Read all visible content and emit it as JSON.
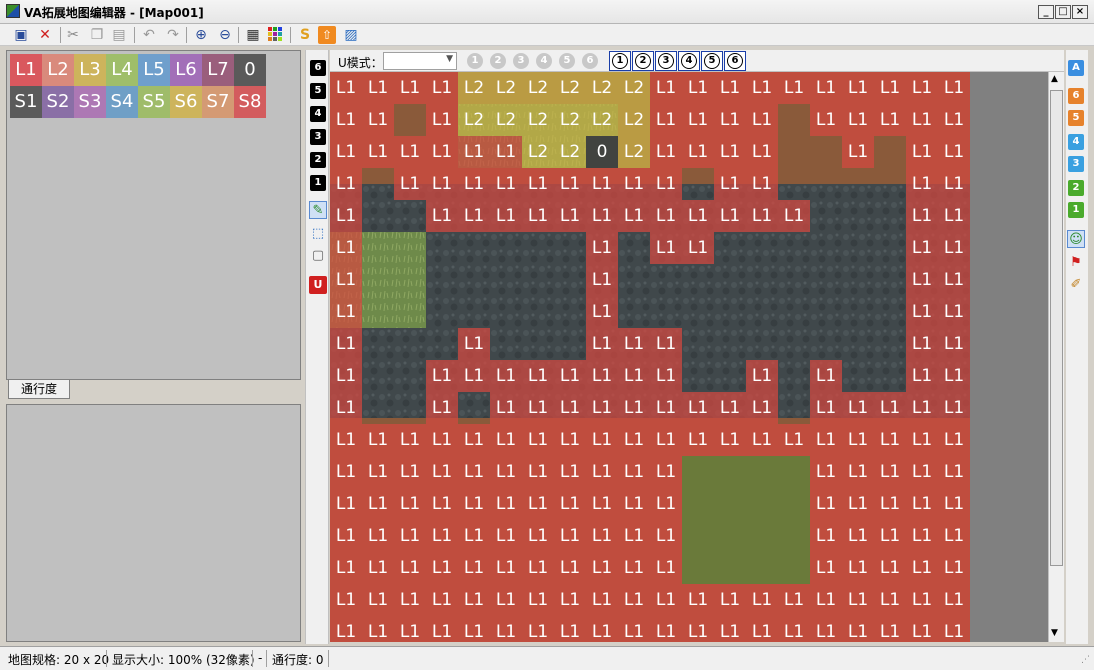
{
  "window": {
    "title": "VA拓展地图编辑器 - [Map001]",
    "buttons": [
      "_",
      "□",
      "×"
    ]
  },
  "toolbar": {
    "icons": [
      "save-icon",
      "delete-icon",
      "cut-icon",
      "copy-icon",
      "paste-icon",
      "undo-icon",
      "redo-icon",
      "zoom-in-icon",
      "zoom-out-icon",
      "grid-icon",
      "palette-icon",
      "script-icon",
      "upload-icon",
      "image-icon"
    ]
  },
  "palette": {
    "row1": [
      {
        "label": "L1",
        "color": "#d9585e"
      },
      {
        "label": "L2",
        "color": "#d98a7c"
      },
      {
        "label": "L3",
        "color": "#cdb45c"
      },
      {
        "label": "L4",
        "color": "#9fbe6a"
      },
      {
        "label": "L5",
        "color": "#6f9fcc"
      },
      {
        "label": "L6",
        "color": "#a26fb8"
      },
      {
        "label": "L7",
        "color": "#9a5e7c"
      },
      {
        "label": "0",
        "color": "#5a5a5a"
      }
    ],
    "row2": [
      {
        "label": "S1",
        "color": "#5b5b5b"
      },
      {
        "label": "S2",
        "color": "#8a6fa6"
      },
      {
        "label": "S3",
        "color": "#ad78b4"
      },
      {
        "label": "S4",
        "color": "#6f9fc6"
      },
      {
        "label": "S5",
        "color": "#9fbc6a"
      },
      {
        "label": "S6",
        "color": "#cdb45c"
      },
      {
        "label": "S7",
        "color": "#d49a74"
      },
      {
        "label": "S8",
        "color": "#d35c5e"
      }
    ]
  },
  "tabs": {
    "passability": "通行度"
  },
  "layer_buttons": [
    "6",
    "5",
    "4",
    "3",
    "2",
    "1"
  ],
  "umode": {
    "label": "U模式：",
    "select_value": "",
    "circles": [
      "1",
      "2",
      "3",
      "4",
      "5",
      "6"
    ],
    "boxes": [
      "1",
      "2",
      "3",
      "4",
      "5",
      "6"
    ]
  },
  "right_buttons": [
    {
      "label": "A",
      "color": "#3a8ee0"
    },
    {
      "label": "6",
      "color": "#e6822c"
    },
    {
      "label": "5",
      "color": "#e6822c"
    },
    {
      "label": "4",
      "color": "#3aa0e0"
    },
    {
      "label": "3",
      "color": "#3aa0e0"
    },
    {
      "label": "2",
      "color": "#4aaa2c"
    },
    {
      "label": "1",
      "color": "#4aaa2c"
    }
  ],
  "map": {
    "rows": [
      "L1 L1 L1 L1 L2 L2 L2 L2 L2 L2 L1 L1 L1 L1 L1 L1 L1 L1 L1 L1",
      "L1 L1 . L1 L2 L2 L2 L2 L2 L2 L1 L1 L1 L1 . L1 L1 L1 L1 L1",
      "L1 L1 L1 L1 L1 L1 L2 L2 0 L2 L1 L1 L1 L1 . . L1 . L1 L1",
      "L1 . L1 L1 L1 L1 L1 L1 L1 L1 L1 . L1 L1 . . . . L1 L1",
      "L1 . . L1 L1 L1 L1 L1 L1 L1 L1 L1 L1 L1 L1 . . . L1 L1",
      "L1 . . . . . . . L1 . L1 L1 . . . . . . L1 L1",
      "L1 . . . . . . . L1 . . . . . . . . . L1 L1",
      "L1 . . . . . . . L1 . . . . . . . . . L1 L1",
      "L1 . . . L1 . . . L1 L1 L1 . . . . . . . L1 L1",
      "L1 . . L1 L1 L1 L1 L1 L1 L1 L1 . . L1 . L1 . . L1 L1",
      "L1 . . L1 . L1 L1 L1 L1 L1 L1 L1 L1 L1 . L1 L1 L1 L1 L1",
      "L1 L1 L1 L1 L1 L1 L1 L1 L1 L1 L1 L1 L1 L1 L1 L1 L1 L1 L1 L1",
      "L1 L1 L1 L1 L1 L1 L1 L1 L1 L1 L1 . . . . L1 L1 L1 L1 L1",
      "L1 L1 L1 L1 L1 L1 L1 L1 L1 L1 L1 . . . . L1 L1 L1 L1 L1",
      "L1 L1 L1 L1 L1 L1 L1 L1 L1 L1 L1 . . . . L1 L1 L1 L1 L1",
      "L1 L1 L1 L1 L1 L1 L1 L1 L1 L1 L1 . . . . L1 L1 L1 L1 L1",
      "L1 L1 L1 L1 L1 L1 L1 L1 L1 L1 L1 L1 L1 L1 L1 L1 L1 L1 L1 L1",
      "L1 L1 L1 L1 L1 L1 L1 L1 L1 L1 L1 L1 L1 L1 L1 L1 L1 L1 L1 L1"
    ]
  },
  "status": {
    "map_size": "地图规格: 20 x 20",
    "zoom": "显示大小: 100% (32像素)",
    "dash": "-",
    "passability": "通行度: 0"
  }
}
